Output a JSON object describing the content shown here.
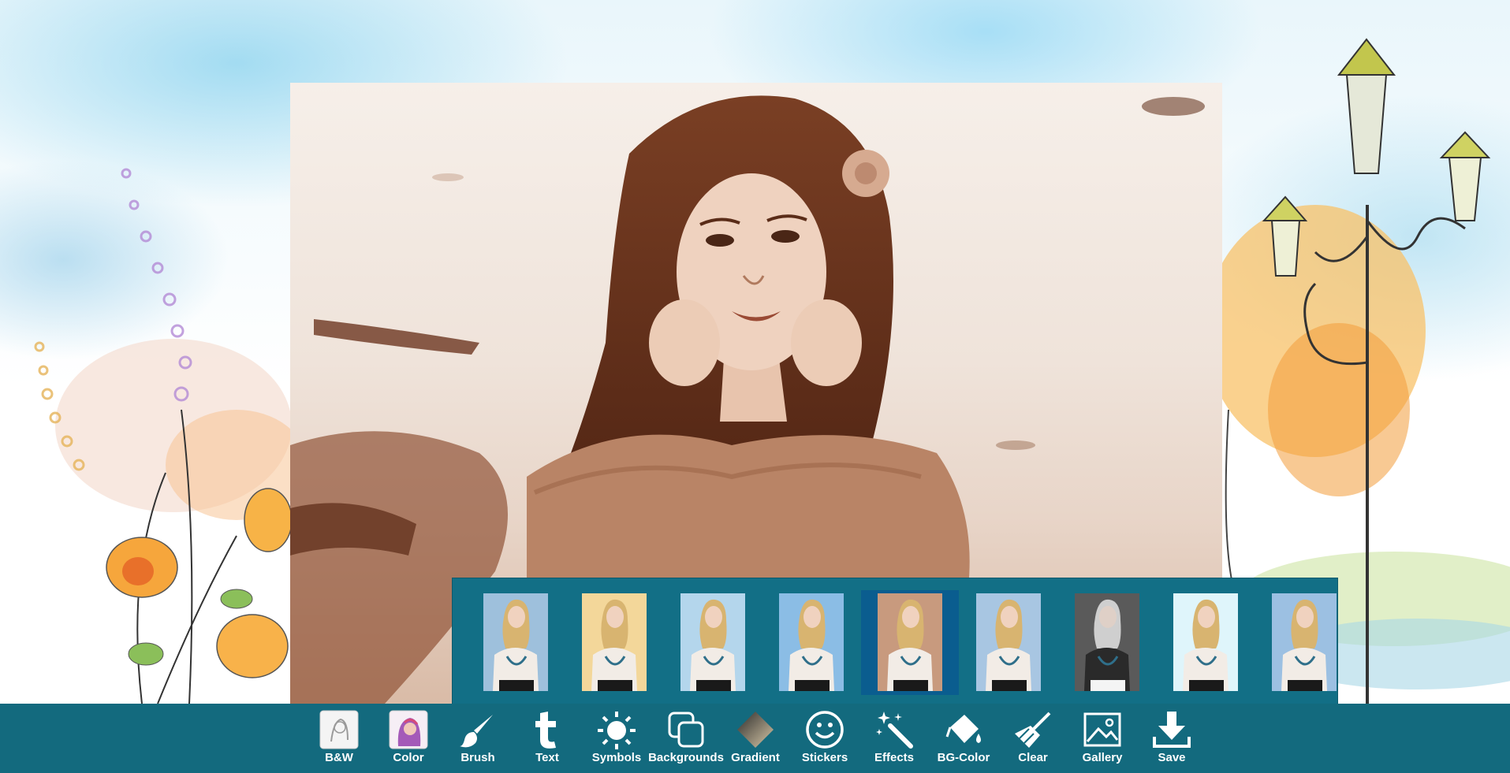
{
  "app": {
    "colors": {
      "toolbar": "#136a7e",
      "filter_strip": "#126f86",
      "selected_filter": "#0a5d8f",
      "icon": "#ffffff"
    }
  },
  "filters": {
    "selected_index": 4,
    "items": [
      {
        "name": "filter-1",
        "tint": "#9ec0dc"
      },
      {
        "name": "filter-2",
        "tint": "#f3d79a"
      },
      {
        "name": "filter-3",
        "tint": "#b4d6ec"
      },
      {
        "name": "filter-4",
        "tint": "#8bbde5"
      },
      {
        "name": "filter-5",
        "tint": "#c89a7e"
      },
      {
        "name": "filter-6",
        "tint": "#a8c6e2"
      },
      {
        "name": "filter-7",
        "tint": "#5a5a5a"
      },
      {
        "name": "filter-8",
        "tint": "#dff5fb"
      },
      {
        "name": "filter-9",
        "tint": "#9cc0e2"
      }
    ]
  },
  "toolbar": {
    "items": [
      {
        "id": "bw",
        "label": "B&W",
        "icon": "bw-thumbnail-icon"
      },
      {
        "id": "color",
        "label": "Color",
        "icon": "color-thumbnail-icon"
      },
      {
        "id": "brush",
        "label": "Brush",
        "icon": "brush-icon"
      },
      {
        "id": "text",
        "label": "Text",
        "icon": "text-icon"
      },
      {
        "id": "symbols",
        "label": "Symbols",
        "icon": "sun-icon"
      },
      {
        "id": "backgrounds",
        "label": "Backgrounds",
        "icon": "layers-icon"
      },
      {
        "id": "gradient",
        "label": "Gradient",
        "icon": "gradient-icon"
      },
      {
        "id": "stickers",
        "label": "Stickers",
        "icon": "smiley-icon"
      },
      {
        "id": "effects",
        "label": "Effects",
        "icon": "magic-wand-icon"
      },
      {
        "id": "bgcolor",
        "label": "BG-Color",
        "icon": "paint-bucket-icon"
      },
      {
        "id": "clear",
        "label": "Clear",
        "icon": "broom-icon"
      },
      {
        "id": "gallery",
        "label": "Gallery",
        "icon": "image-icon"
      },
      {
        "id": "save",
        "label": "Save",
        "icon": "download-icon"
      }
    ]
  }
}
